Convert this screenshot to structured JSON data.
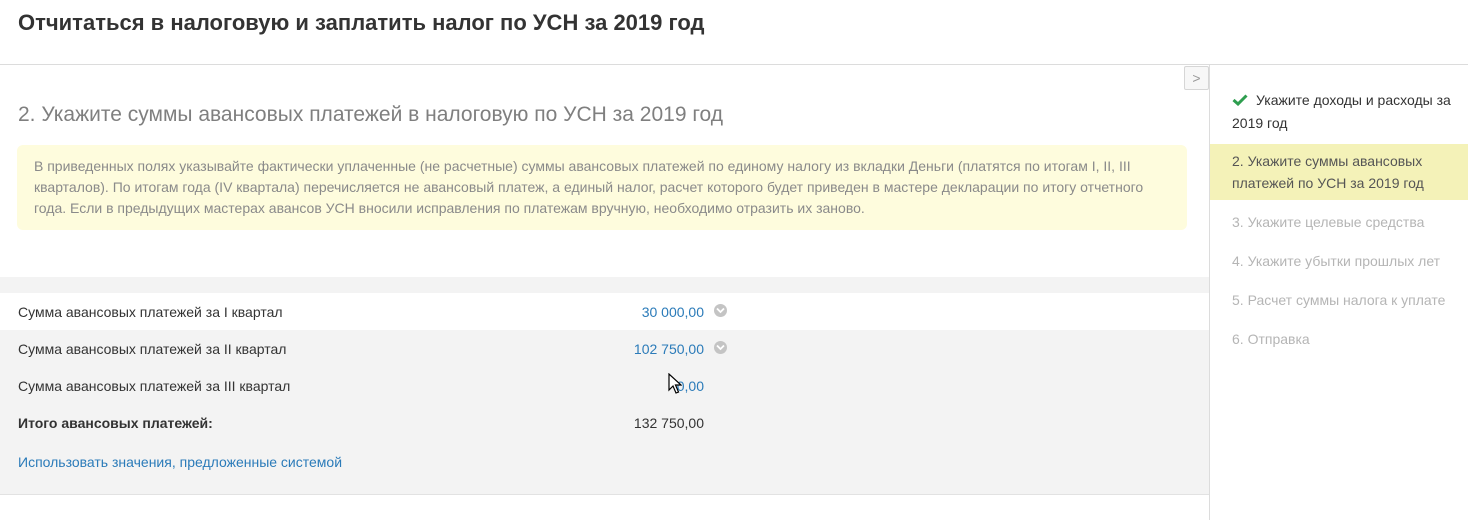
{
  "header": {
    "title": "Отчитаться в налоговую и заплатить налог по УСН за 2019 год"
  },
  "main": {
    "collapse_label": ">",
    "section_title": "2. Укажите суммы авансовых платежей в налоговую по УСН за 2019 год",
    "info_text": "В приведенных полях указывайте фактически уплаченные (не расчетные) суммы авансовых платежей по единому налогу из вкладки Деньги (платятся по итогам I, II, III кварталов). По итогам года (IV квартала) перечисляется не авансовый платеж, а единый налог, расчет которого будет приведен в мастере декларации по итогу отчетного года. Если в предыдущих мастерах авансов УСН вносили исправления по платежам вручную, необходимо отразить их заново.",
    "rows": [
      {
        "label": "Сумма авансовых платежей за I квартал",
        "value": "30 000,00"
      },
      {
        "label": "Сумма авансовых платежей за II квартал",
        "value": "102 750,00"
      },
      {
        "label": "Сумма авансовых платежей за III квартал",
        "value": "0,00"
      }
    ],
    "total": {
      "label": "Итого авансовых платежей:",
      "value": "132 750,00"
    },
    "system_link": "Использовать значения, предложенные системой"
  },
  "sidebar": {
    "steps": [
      {
        "label": "Укажите доходы и расходы за 2019 год",
        "state": "done"
      },
      {
        "label": "2.  Укажите суммы авансовых платежей по УСН за 2019 год",
        "state": "active"
      },
      {
        "label": "3.  Укажите целевые средства",
        "state": "pending"
      },
      {
        "label": "4.  Укажите убытки прошлых лет",
        "state": "pending"
      },
      {
        "label": "5.  Расчет суммы налога к уплате",
        "state": "pending"
      },
      {
        "label": "6.  Отправка",
        "state": "pending"
      }
    ]
  },
  "colors": {
    "accent_link": "#2b7bb9",
    "info_bg": "#fefcdd",
    "active_step_bg": "#f4f2b8",
    "check_green": "#2e9e4f"
  }
}
